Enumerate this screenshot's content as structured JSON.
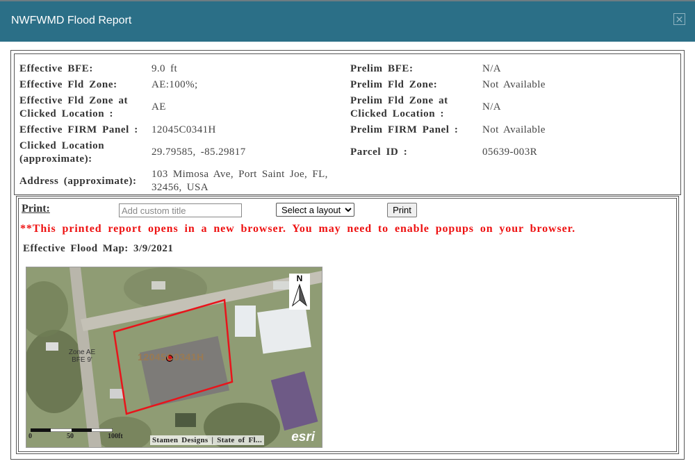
{
  "dialog": {
    "title": "NWFWMD Flood Report",
    "close_glyph": "✕"
  },
  "report": {
    "left": [
      {
        "label": "Effective BFE:",
        "value": "9.0 ft"
      },
      {
        "label": "Effective Fld Zone:",
        "value": "AE:100%;"
      },
      {
        "label_line1": "Effective Fld Zone at",
        "label_line2": "Clicked Location :",
        "value": "AE"
      },
      {
        "label": "Effective FIRM Panel :",
        "value": "12045C0341H"
      },
      {
        "label_line1": "Clicked Location",
        "label_line2": "(approximate):",
        "value": "29.79585, -85.29817"
      },
      {
        "label": "Address (approximate):",
        "value_line1": "103 Mimosa Ave, Port Saint Joe, FL,",
        "value_line2": "32456, USA"
      }
    ],
    "right": [
      {
        "label": "Prelim BFE:",
        "value": "N/A"
      },
      {
        "label": "Prelim Fld Zone:",
        "value": "Not Available"
      },
      {
        "label_line1": "Prelim Fld Zone at",
        "label_line2": "Clicked Location :",
        "value": "N/A"
      },
      {
        "label": "Prelim FIRM Panel :",
        "value": "Not Available"
      },
      {
        "label": "Parcel ID :",
        "value": "05639-003R"
      }
    ]
  },
  "print": {
    "label": "Print:",
    "title_placeholder": "Add custom title",
    "layout_options": [
      "Select a layout"
    ],
    "layout_selected": "Select a layout",
    "button": "Print",
    "warning": "**This printed report opens in a new browser. You may need to enable popups on your browser."
  },
  "map": {
    "title": "Effective Flood Map: 3/9/2021",
    "zone_label_line1": "Zone AE",
    "zone_label_line2": "BFE 9'",
    "panel_label": "12045C0341H",
    "north_label": "N",
    "scale_labels": [
      "0",
      "50",
      "100ft"
    ],
    "attribution": "Stamen Designs | State of Fl...",
    "esri": "esri",
    "parcel_color": "#e8141b"
  }
}
